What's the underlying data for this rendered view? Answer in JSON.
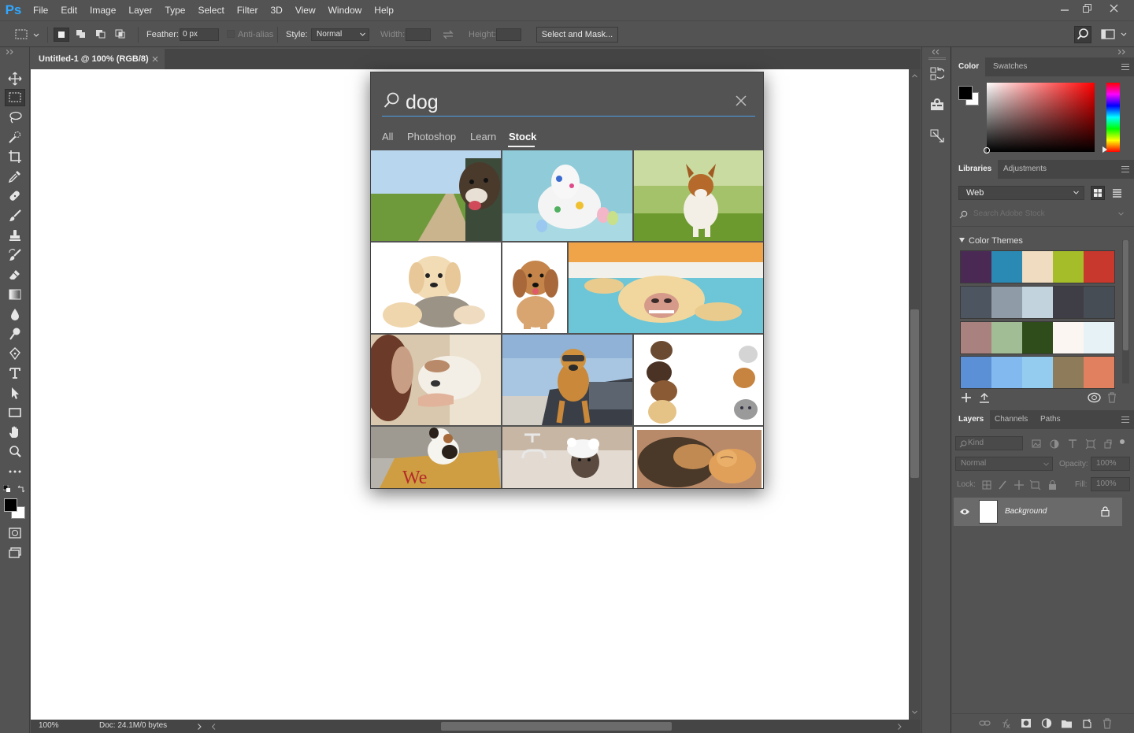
{
  "app": {
    "logo_text": "Ps",
    "menu": [
      "File",
      "Edit",
      "Image",
      "Layer",
      "Type",
      "Select",
      "Filter",
      "3D",
      "View",
      "Window",
      "Help"
    ]
  },
  "options_bar": {
    "feather_label": "Feather:",
    "feather_value": "0 px",
    "antialias_label": "Anti-alias",
    "style_label": "Style:",
    "style_value": "Normal",
    "width_label": "Width:",
    "height_label": "Height:",
    "select_mask_label": "Select and Mask..."
  },
  "document": {
    "tab_title": "Untitled-1 @ 100% (RGB/8)",
    "zoom": "100%",
    "doc_info": "Doc: 24.1M/0 bytes"
  },
  "search": {
    "query": "dog",
    "tabs": [
      "All",
      "Photoshop",
      "Learn",
      "Stock"
    ],
    "active_tab": "Stock"
  },
  "color_panel": {
    "tabs": [
      "Color",
      "Swatches"
    ],
    "foreground": "#000000",
    "background": "#ffffff"
  },
  "libraries_panel": {
    "tabs": [
      "Libraries",
      "Adjustments"
    ],
    "library": "Web",
    "search_placeholder": "Search Adobe Stock",
    "section_title": "Color Themes",
    "themes": [
      [
        "#4a2a55",
        "#2b8ab3",
        "#f0dcc0",
        "#a6bd2a",
        "#c8382d"
      ],
      [
        "#4d5560",
        "#8f9ba6",
        "#c3d3de",
        "#3f3d45",
        "#474d55"
      ],
      [
        "#a9817e",
        "#a1bd96",
        "#2f4d1a",
        "#fcf6f2",
        "#e6f2f6"
      ],
      [
        "#5b8fd6",
        "#82baf0",
        "#94ccf0",
        "#8d7b5a",
        "#e0805f"
      ]
    ]
  },
  "layers_panel": {
    "tabs": [
      "Layers",
      "Channels",
      "Paths"
    ],
    "filter_placeholder": "Kind",
    "blend_mode": "Normal",
    "opacity_label": "Opacity:",
    "opacity_value": "100%",
    "lock_label": "Lock:",
    "fill_label": "Fill:",
    "fill_value": "100%",
    "layers": [
      {
        "name": "Background"
      }
    ]
  }
}
